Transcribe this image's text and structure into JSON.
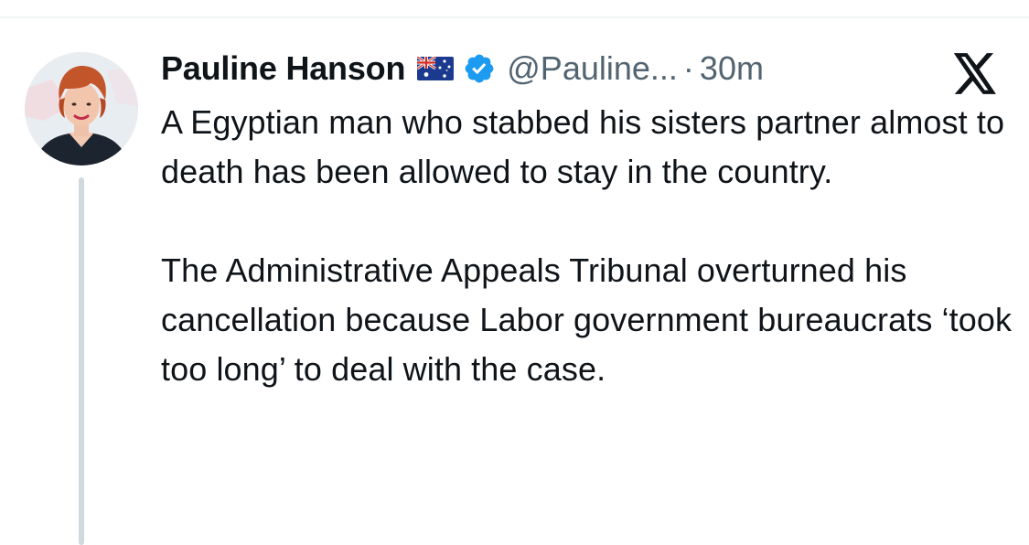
{
  "tweet": {
    "author": {
      "display_name": "Pauline Hanson",
      "handle": "@Pauline...",
      "flag": "australia-flag-icon",
      "verified": true,
      "verified_color": "#1d9bf0"
    },
    "separator": "·",
    "time": "30m",
    "platform_logo": "x-logo-icon",
    "paragraphs": [
      "A Egyptian man who stabbed his sisters partner almost to death has been allowed to stay in the country.",
      "The Administrative Appeals Tribunal overturned his cancellation because Labor government bureaucrats ‘took too long’ to deal with the case."
    ]
  },
  "colors": {
    "text": "#0f1419",
    "secondary_text": "#536471",
    "thread_line": "#cfd9de",
    "background": "#ffffff"
  }
}
